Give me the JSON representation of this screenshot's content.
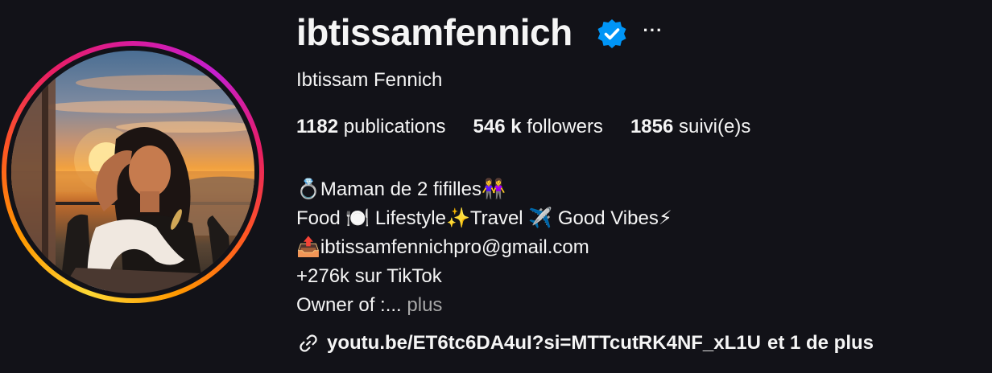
{
  "profile": {
    "username": "ibtissamfennich",
    "full_name": "Ibtissam Fennich",
    "more_options": "···"
  },
  "stats": {
    "posts_count": "1182",
    "posts_label": "publications",
    "followers_count": "546 k",
    "followers_label": "followers",
    "following_count": "1856",
    "following_label": "suivi(e)s"
  },
  "bio": {
    "line1": "💍Maman de 2 fifilles👭",
    "line2": "Food 🍽️ Lifestyle✨Travel ✈️ Good Vibes⚡",
    "line3": "📤ibtissamfennichpro@gmail.com",
    "line4": "+276k sur TikTok",
    "line5": "Owner of :...",
    "more_label": "plus"
  },
  "link": {
    "url_text": "youtu.be/ET6tc6DA4uI?si=MTTcutRK4NF_xL1U",
    "more_text": "et 1 de plus"
  },
  "colors": {
    "background": "#121218",
    "text": "#f5f5f5",
    "secondary_text": "#a8a8a8",
    "verified_blue": "#0095f6"
  }
}
